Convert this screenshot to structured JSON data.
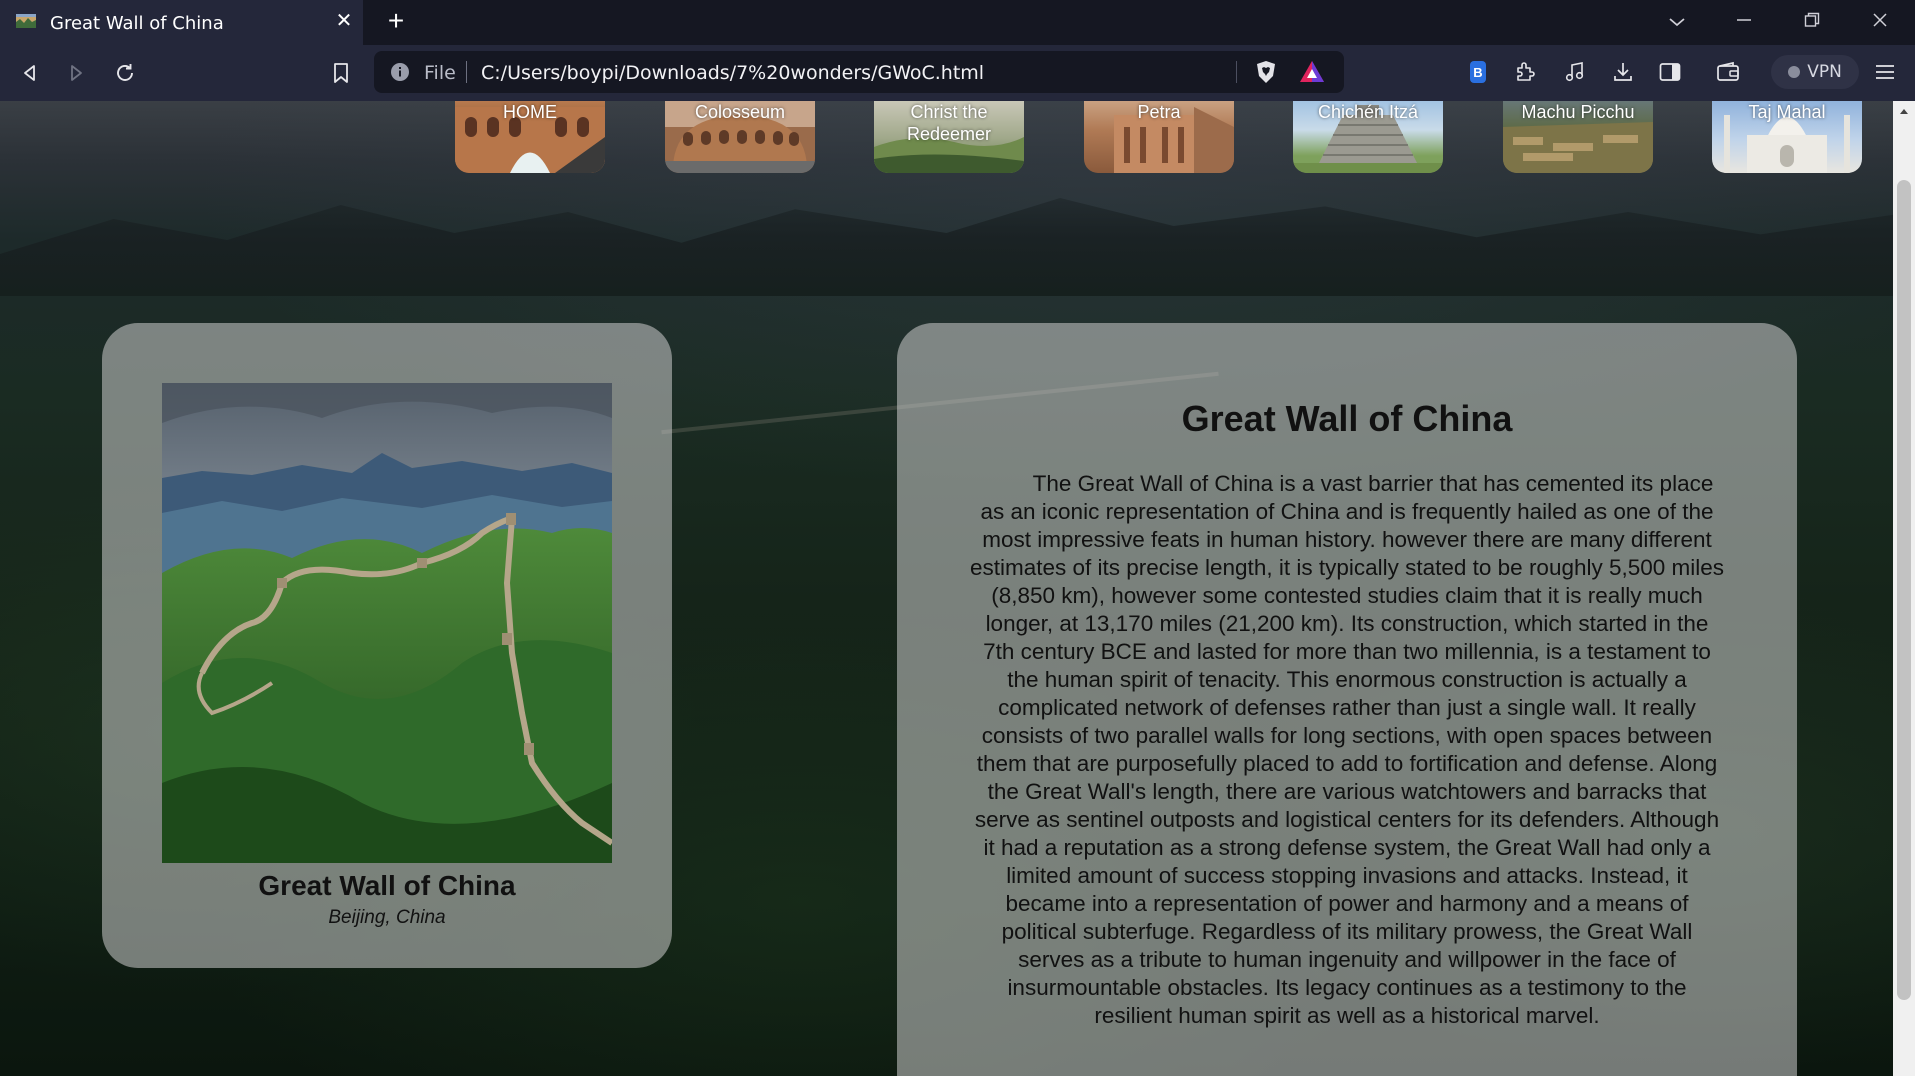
{
  "browser": {
    "tab_title": "Great Wall of China",
    "url_scheme": "File",
    "url": "C:/Users/boypi/Downloads/7%20wonders/GWoC.html",
    "vpn_label": "VPN"
  },
  "nav": {
    "items": [
      {
        "label": "HOME"
      },
      {
        "label": "Colosseum"
      },
      {
        "label": "Christ the Redeemer"
      },
      {
        "label": "Petra"
      },
      {
        "label": "Chichén Itzá"
      },
      {
        "label": "Machu Picchu"
      },
      {
        "label": "Taj Mahal"
      }
    ]
  },
  "feature": {
    "title": "Great Wall of China",
    "location": "Beijing, China"
  },
  "article": {
    "title": "Great Wall of China",
    "body": "The Great Wall of China is a vast barrier that has cemented its place as an iconic representation of China and is frequently hailed as one of the most impressive feats in human history. however there are many different estimates of its precise length, it is typically stated to be roughly 5,500 miles (8,850 km), however some contested studies claim that it is really much longer, at 13,170 miles (21,200 km). Its construction, which started in the 7th century BCE and lasted for more than two millennia, is a testament to the human spirit of tenacity. This enormous construction is actually a complicated network of defenses rather than just a single wall. It really consists of two parallel walls for long sections, with open spaces between them that are purposefully placed to add to fortification and defense. Along the Great Wall's length, there are various watchtowers and barracks that serve as sentinel outposts and logistical centers for its defenders. Although it had a reputation as a strong defense system, the Great Wall had only a limited amount of success stopping invasions and attacks. Instead, it became into a representation of power and harmony and a means of political subterfuge. Regardless of its military prowess, the Great Wall serves as a tribute to human ingenuity and willpower in the face of insurmountable obstacles. Its legacy continues as a testimony to the resilient human spirit as well as a historical marvel."
  },
  "colors": {
    "chrome_dark": "#151722",
    "chrome": "#24273a",
    "card_bg": "rgba(205,205,205,0.55)",
    "text": "#111111"
  }
}
